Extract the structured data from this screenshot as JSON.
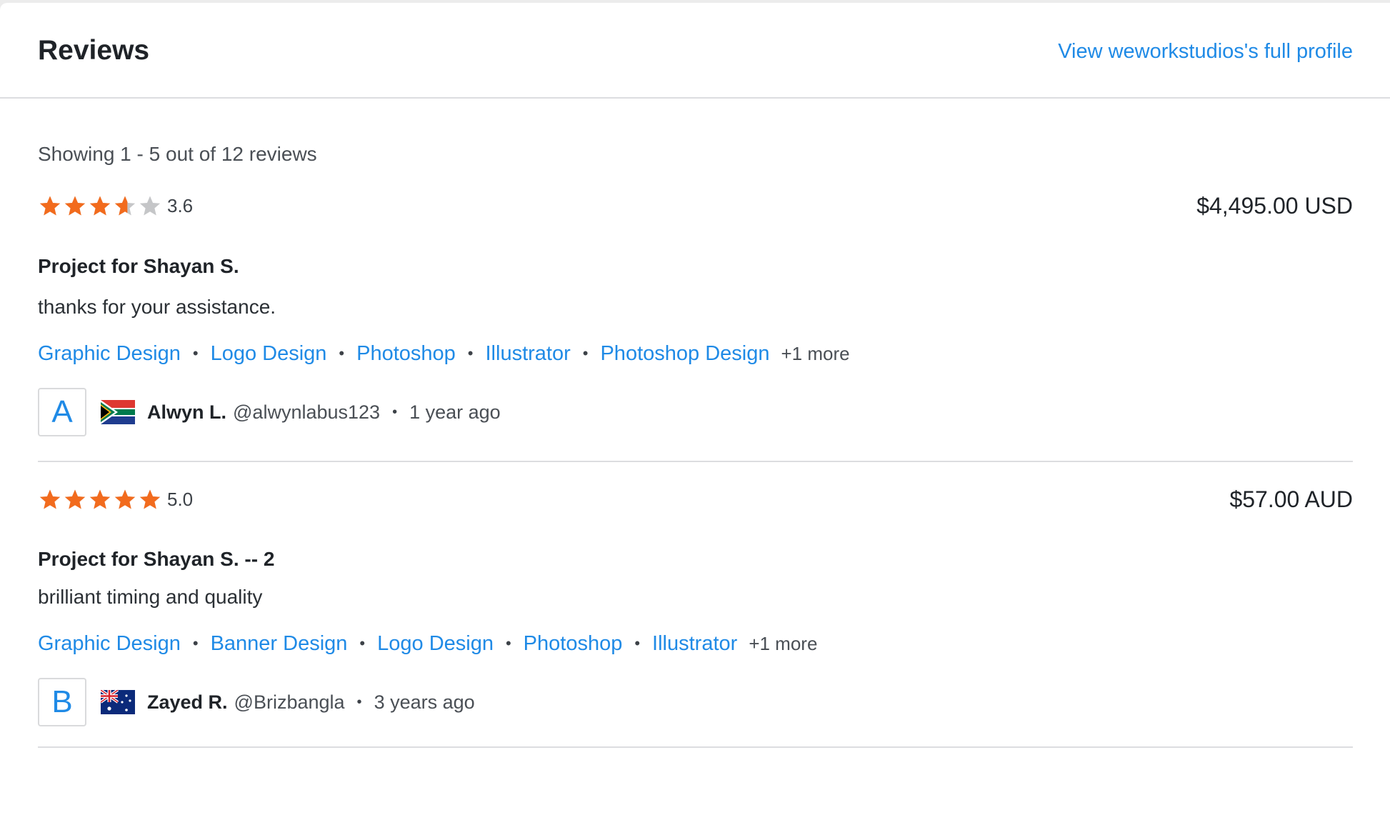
{
  "header": {
    "title": "Reviews",
    "profile_link": "View weworkstudios's full profile"
  },
  "summary": "Showing 1 - 5 out of 12 reviews",
  "colors": {
    "accent": "#1f8ae6",
    "star": "#f26b1d",
    "star_empty": "#c5c6c8"
  },
  "reviews": [
    {
      "rating": 3.6,
      "score": "3.6",
      "amount": "$4,495.00 USD",
      "title": "Project for Shayan S.",
      "text": "thanks for your assistance.",
      "skills": [
        "Graphic Design",
        "Logo Design",
        "Photoshop",
        "Illustrator",
        "Photoshop Design"
      ],
      "more": "+1 more",
      "reviewer": {
        "initial": "A",
        "flag": "south-africa-flag-icon",
        "name": "Alwyn L.",
        "handle": "@alwynlabus123",
        "time": "1 year ago"
      }
    },
    {
      "rating": 5.0,
      "score": "5.0",
      "amount": "$57.00 AUD",
      "title": "Project for Shayan S. -- 2",
      "text": "brilliant timing and quality",
      "skills": [
        "Graphic Design",
        "Banner Design",
        "Logo Design",
        "Photoshop",
        "Illustrator"
      ],
      "more": "+1 more",
      "reviewer": {
        "initial": "B",
        "flag": "australia-flag-icon",
        "name": "Zayed R.",
        "handle": "@Brizbangla",
        "time": "3 years ago"
      }
    }
  ]
}
